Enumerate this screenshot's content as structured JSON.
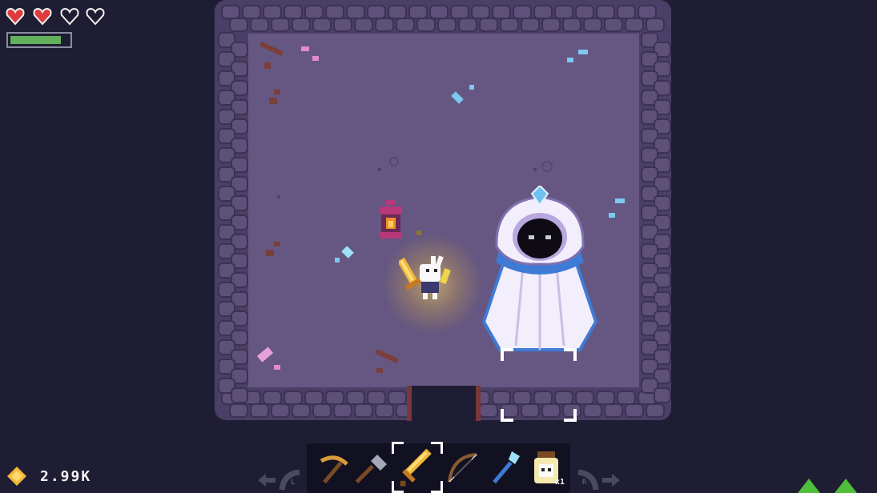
{
  "hud": {
    "hearts": [
      {
        "state": "full",
        "icon": "heart-full-icon"
      },
      {
        "state": "full",
        "icon": "heart-full-icon"
      },
      {
        "state": "empty",
        "icon": "heart-empty-icon"
      },
      {
        "state": "empty",
        "icon": "heart-empty-icon"
      }
    ],
    "stamina_fraction": 0.88,
    "stamina_color": "#5fb15a",
    "currency": {
      "icon": "gem-coin-icon",
      "value": "2.99K",
      "color": "#f2b83a"
    }
  },
  "hotbar": {
    "items": [
      {
        "name": "pickaxe",
        "icon": "pickaxe-icon"
      },
      {
        "name": "shovel",
        "icon": "shovel-icon"
      },
      {
        "name": "golden-sword",
        "icon": "sword-icon",
        "selected": true
      },
      {
        "name": "bow",
        "icon": "bow-icon"
      },
      {
        "name": "ice-rod",
        "icon": "ice-rod-icon"
      },
      {
        "name": "bottled-skull",
        "icon": "skull-jar-icon",
        "quantity": "x1"
      }
    ],
    "left_cycle_key": "L",
    "right_cycle_key": "R"
  },
  "scene": {
    "boss": {
      "name": "hooded-wraith",
      "color_cloak": "#f2eefc",
      "color_trim": "#3e7ad6",
      "color_gem": "#6fc0f0"
    },
    "player": {
      "weapon": "golden-sword"
    },
    "lantern_color": "#b8387a"
  }
}
